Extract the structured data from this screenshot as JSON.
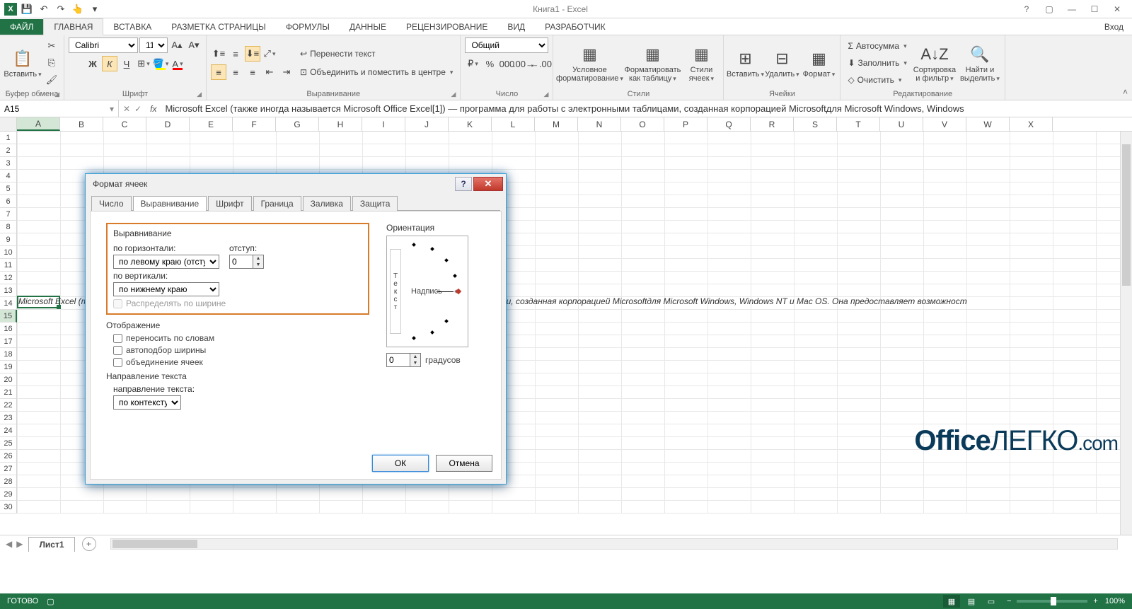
{
  "app": {
    "title": "Книга1 - Excel",
    "signin": "Вход"
  },
  "ribbon_tabs": {
    "file": "ФАЙЛ",
    "home": "ГЛАВНАЯ",
    "insert": "ВСТАВКА",
    "layout": "РАЗМЕТКА СТРАНИЦЫ",
    "formulas": "ФОРМУЛЫ",
    "data": "ДАННЫЕ",
    "review": "РЕЦЕНЗИРОВАНИЕ",
    "view": "ВИД",
    "developer": "РАЗРАБОТЧИК"
  },
  "ribbon": {
    "clipboard": {
      "paste": "Вставить",
      "label": "Буфер обмена"
    },
    "font": {
      "name": "Calibri",
      "size": "11",
      "label": "Шрифт"
    },
    "align": {
      "wrap": "Перенести текст",
      "merge": "Объединить и поместить в центре",
      "label": "Выравнивание"
    },
    "number": {
      "format": "Общий",
      "label": "Число"
    },
    "styles": {
      "cond": "Условное форматирование",
      "table": "Форматировать как таблицу",
      "cell": "Стили ячеек",
      "label": "Стили"
    },
    "cells": {
      "insert": "Вставить",
      "delete": "Удалить",
      "format": "Формат",
      "label": "Ячейки"
    },
    "editing": {
      "sum": "Автосумма",
      "fill": "Заполнить",
      "clear": "Очистить",
      "sort": "Сортировка и фильтр",
      "find": "Найти и выделить",
      "label": "Редактирование"
    }
  },
  "formula_bar": {
    "cell_ref": "A15",
    "text": "Microsoft Excel (также иногда называется Microsoft Office Excel[1]) — программа для работы с электронными таблицами, созданная корпорацией Microsoftдля Microsoft Windows, Windows"
  },
  "columns": [
    "A",
    "B",
    "C",
    "D",
    "E",
    "F",
    "G",
    "H",
    "I",
    "J",
    "K",
    "L",
    "M",
    "N",
    "O",
    "P",
    "Q",
    "R",
    "S",
    "T",
    "U",
    "V",
    "W",
    "X"
  ],
  "row_count": 30,
  "selected_row": 15,
  "cell_content": "Microsoft Excel (также иногда называется Microsoft Office Excel[1]) — программа для работы с электронными таблицами, созданная корпорацией Microsoftдля Microsoft Windows, Windows NT и Mac OS. Она предоставляет возможност",
  "sheet": {
    "name": "Лист1"
  },
  "status": {
    "ready": "ГОТОВО",
    "zoom": "100%"
  },
  "dialog": {
    "title": "Формат ячеек",
    "tabs": {
      "number": "Число",
      "align": "Выравнивание",
      "font": "Шрифт",
      "border": "Граница",
      "fill": "Заливка",
      "protect": "Защита"
    },
    "align_sect": "Выравнивание",
    "horiz_label": "по горизонтали:",
    "horiz_value": "по левому краю (отступ)",
    "indent_label": "отступ:",
    "indent_value": "0",
    "vert_label": "по вертикали:",
    "vert_value": "по нижнему краю",
    "distribute": "Распределять по ширине",
    "display_sect": "Отображение",
    "wrap_chk": "переносить по словам",
    "shrink_chk": "автоподбор ширины",
    "merge_chk": "объединение ячеек",
    "textdir_sect": "Направление текста",
    "textdir_label": "направление текста:",
    "textdir_value": "по контексту",
    "orient_sect": "Ориентация",
    "orient_vert": "Текст",
    "orient_label": "Надпись",
    "degrees_value": "0",
    "degrees_label": "градусов",
    "ok": "ОК",
    "cancel": "Отмена"
  },
  "watermark": {
    "a": "Office",
    "b": "ЛЕГКО",
    "c": ".com"
  }
}
